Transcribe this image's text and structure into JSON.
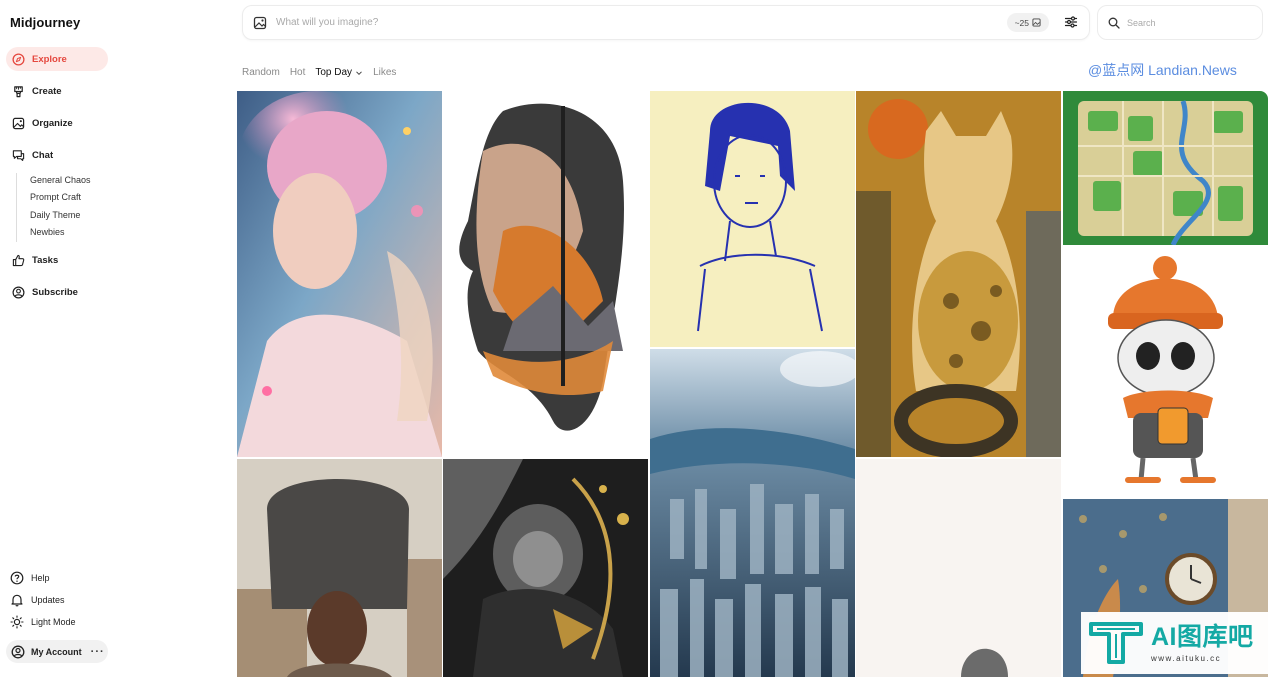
{
  "app": {
    "title": "Midjourney"
  },
  "sidebar": {
    "items": [
      {
        "label": "Explore",
        "icon": "compass-icon",
        "active": true
      },
      {
        "label": "Create",
        "icon": "brush-icon"
      },
      {
        "label": "Organize",
        "icon": "image-icon"
      },
      {
        "label": "Chat",
        "icon": "chat-icon"
      },
      {
        "label": "Tasks",
        "icon": "thumbs-up-icon"
      },
      {
        "label": "Subscribe",
        "icon": "user-circle-icon"
      }
    ],
    "chat_rooms": [
      "General Chaos",
      "Prompt Craft",
      "Daily Theme",
      "Newbies"
    ],
    "bottom": [
      {
        "label": "Help",
        "icon": "help-icon"
      },
      {
        "label": "Updates",
        "icon": "bell-icon"
      },
      {
        "label": "Light Mode",
        "icon": "sun-icon"
      }
    ],
    "account": {
      "label": "My Account",
      "menu": "···"
    }
  },
  "topbar": {
    "imagine_placeholder": "What will you imagine?",
    "credits": "~25",
    "search_placeholder": "Search"
  },
  "filters": {
    "options": [
      "Random",
      "Hot",
      "Top Day",
      "Likes"
    ],
    "selected": "Top Day"
  },
  "watermarks": {
    "top": "@蓝点网 Landian.News",
    "logo_text": "AI图库吧",
    "url": "www.aituku.cc"
  },
  "colors": {
    "accent": "#e5483f",
    "accent_bg": "#fde9e7",
    "watermark": "#14a9a4"
  }
}
